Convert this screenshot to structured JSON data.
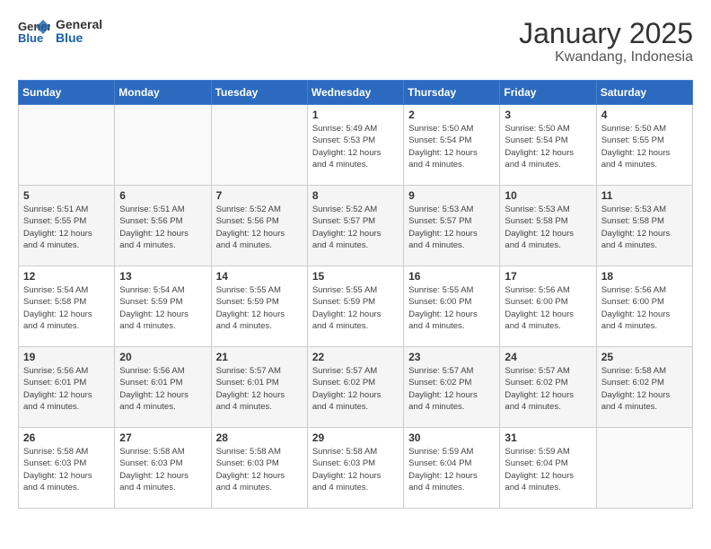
{
  "header": {
    "logo_line1": "General",
    "logo_line2": "Blue",
    "month": "January 2025",
    "location": "Kwandang, Indonesia"
  },
  "days_of_week": [
    "Sunday",
    "Monday",
    "Tuesday",
    "Wednesday",
    "Thursday",
    "Friday",
    "Saturday"
  ],
  "weeks": [
    [
      {
        "day": "",
        "info": ""
      },
      {
        "day": "",
        "info": ""
      },
      {
        "day": "",
        "info": ""
      },
      {
        "day": "1",
        "info": "Sunrise: 5:49 AM\nSunset: 5:53 PM\nDaylight: 12 hours\nand 4 minutes."
      },
      {
        "day": "2",
        "info": "Sunrise: 5:50 AM\nSunset: 5:54 PM\nDaylight: 12 hours\nand 4 minutes."
      },
      {
        "day": "3",
        "info": "Sunrise: 5:50 AM\nSunset: 5:54 PM\nDaylight: 12 hours\nand 4 minutes."
      },
      {
        "day": "4",
        "info": "Sunrise: 5:50 AM\nSunset: 5:55 PM\nDaylight: 12 hours\nand 4 minutes."
      }
    ],
    [
      {
        "day": "5",
        "info": "Sunrise: 5:51 AM\nSunset: 5:55 PM\nDaylight: 12 hours\nand 4 minutes."
      },
      {
        "day": "6",
        "info": "Sunrise: 5:51 AM\nSunset: 5:56 PM\nDaylight: 12 hours\nand 4 minutes."
      },
      {
        "day": "7",
        "info": "Sunrise: 5:52 AM\nSunset: 5:56 PM\nDaylight: 12 hours\nand 4 minutes."
      },
      {
        "day": "8",
        "info": "Sunrise: 5:52 AM\nSunset: 5:57 PM\nDaylight: 12 hours\nand 4 minutes."
      },
      {
        "day": "9",
        "info": "Sunrise: 5:53 AM\nSunset: 5:57 PM\nDaylight: 12 hours\nand 4 minutes."
      },
      {
        "day": "10",
        "info": "Sunrise: 5:53 AM\nSunset: 5:58 PM\nDaylight: 12 hours\nand 4 minutes."
      },
      {
        "day": "11",
        "info": "Sunrise: 5:53 AM\nSunset: 5:58 PM\nDaylight: 12 hours\nand 4 minutes."
      }
    ],
    [
      {
        "day": "12",
        "info": "Sunrise: 5:54 AM\nSunset: 5:58 PM\nDaylight: 12 hours\nand 4 minutes."
      },
      {
        "day": "13",
        "info": "Sunrise: 5:54 AM\nSunset: 5:59 PM\nDaylight: 12 hours\nand 4 minutes."
      },
      {
        "day": "14",
        "info": "Sunrise: 5:55 AM\nSunset: 5:59 PM\nDaylight: 12 hours\nand 4 minutes."
      },
      {
        "day": "15",
        "info": "Sunrise: 5:55 AM\nSunset: 5:59 PM\nDaylight: 12 hours\nand 4 minutes."
      },
      {
        "day": "16",
        "info": "Sunrise: 5:55 AM\nSunset: 6:00 PM\nDaylight: 12 hours\nand 4 minutes."
      },
      {
        "day": "17",
        "info": "Sunrise: 5:56 AM\nSunset: 6:00 PM\nDaylight: 12 hours\nand 4 minutes."
      },
      {
        "day": "18",
        "info": "Sunrise: 5:56 AM\nSunset: 6:00 PM\nDaylight: 12 hours\nand 4 minutes."
      }
    ],
    [
      {
        "day": "19",
        "info": "Sunrise: 5:56 AM\nSunset: 6:01 PM\nDaylight: 12 hours\nand 4 minutes."
      },
      {
        "day": "20",
        "info": "Sunrise: 5:56 AM\nSunset: 6:01 PM\nDaylight: 12 hours\nand 4 minutes."
      },
      {
        "day": "21",
        "info": "Sunrise: 5:57 AM\nSunset: 6:01 PM\nDaylight: 12 hours\nand 4 minutes."
      },
      {
        "day": "22",
        "info": "Sunrise: 5:57 AM\nSunset: 6:02 PM\nDaylight: 12 hours\nand 4 minutes."
      },
      {
        "day": "23",
        "info": "Sunrise: 5:57 AM\nSunset: 6:02 PM\nDaylight: 12 hours\nand 4 minutes."
      },
      {
        "day": "24",
        "info": "Sunrise: 5:57 AM\nSunset: 6:02 PM\nDaylight: 12 hours\nand 4 minutes."
      },
      {
        "day": "25",
        "info": "Sunrise: 5:58 AM\nSunset: 6:02 PM\nDaylight: 12 hours\nand 4 minutes."
      }
    ],
    [
      {
        "day": "26",
        "info": "Sunrise: 5:58 AM\nSunset: 6:03 PM\nDaylight: 12 hours\nand 4 minutes."
      },
      {
        "day": "27",
        "info": "Sunrise: 5:58 AM\nSunset: 6:03 PM\nDaylight: 12 hours\nand 4 minutes."
      },
      {
        "day": "28",
        "info": "Sunrise: 5:58 AM\nSunset: 6:03 PM\nDaylight: 12 hours\nand 4 minutes."
      },
      {
        "day": "29",
        "info": "Sunrise: 5:58 AM\nSunset: 6:03 PM\nDaylight: 12 hours\nand 4 minutes."
      },
      {
        "day": "30",
        "info": "Sunrise: 5:59 AM\nSunset: 6:04 PM\nDaylight: 12 hours\nand 4 minutes."
      },
      {
        "day": "31",
        "info": "Sunrise: 5:59 AM\nSunset: 6:04 PM\nDaylight: 12 hours\nand 4 minutes."
      },
      {
        "day": "",
        "info": ""
      }
    ]
  ]
}
